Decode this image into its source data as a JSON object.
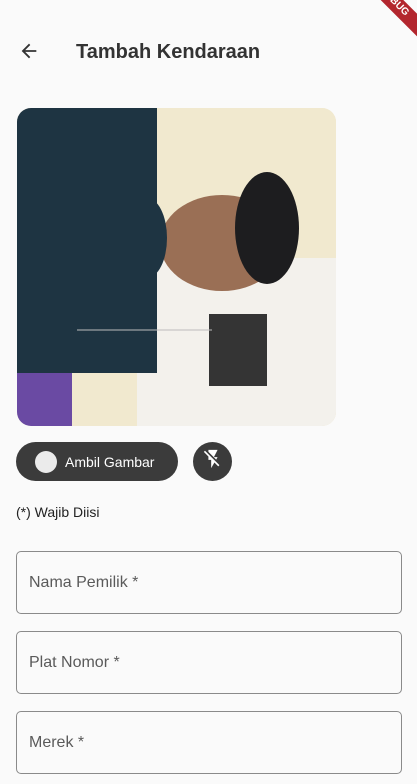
{
  "appbar": {
    "title": "Tambah Kendaraan",
    "back_icon": "arrow-left-icon",
    "debug_banner": "DEBUG"
  },
  "camera": {
    "capture_label": "Ambil Gambar",
    "flash_icon": "flash-off-icon"
  },
  "form": {
    "required_note": "(*) Wajib Diisi",
    "fields": [
      {
        "placeholder": "Nama Pemilik *",
        "value": ""
      },
      {
        "placeholder": "Plat Nomor *",
        "value": ""
      },
      {
        "placeholder": "Merek *",
        "value": ""
      }
    ]
  },
  "colors": {
    "button_bg": "#3b3b3b",
    "debug_banner": "#b3262e",
    "field_border": "#8a8a8a"
  }
}
